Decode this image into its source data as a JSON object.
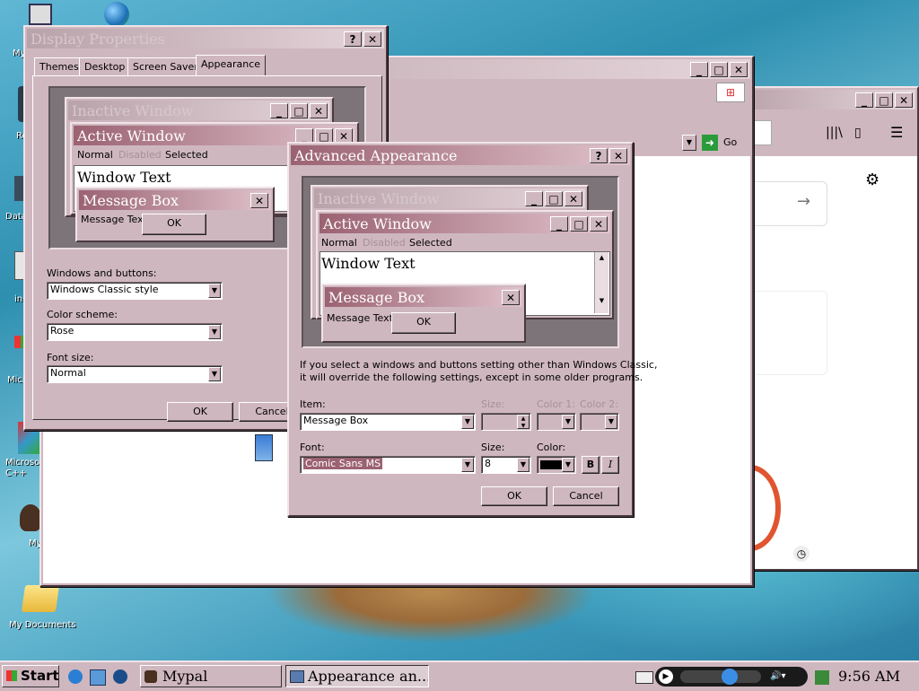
{
  "desktop": {
    "icons": [
      {
        "label": "My",
        "icon": "my-computer-icon"
      },
      {
        "label": "Re",
        "icon": "recycle-bin-icon"
      },
      {
        "label": "Data",
        "icon": "data-icon"
      },
      {
        "label": "ins",
        "icon": "installer-icon"
      },
      {
        "label": "Micro",
        "icon": "microsoft-icon"
      },
      {
        "label": "Microsoft C++",
        "icon": "cpp-shortcut-icon"
      },
      {
        "label": "My",
        "icon": "monkey-shortcut-icon"
      },
      {
        "label": "My Documents",
        "icon": "folder-icon"
      }
    ]
  },
  "browser": {
    "go_label": "Go"
  },
  "display_properties": {
    "title": "Display Properties",
    "tabs": [
      "Themes",
      "Desktop",
      "Screen Saver",
      "Appearance"
    ],
    "preview": {
      "inactive_title": "Inactive Window",
      "active_title": "Active Window",
      "menu_normal": "Normal",
      "menu_disabled": "Disabled",
      "menu_selected": "Selected",
      "window_text": "Window Text",
      "msgbox_title": "Message Box",
      "msgbox_text": "Message Text",
      "msgbox_ok": "OK"
    },
    "windows_buttons_label": "Windows and buttons:",
    "windows_buttons_value": "Windows Classic style",
    "color_scheme_label": "Color scheme:",
    "color_scheme_value": "Rose",
    "font_size_label": "Font size:",
    "font_size_value": "Normal",
    "ok": "OK",
    "cancel": "Cancel"
  },
  "advanced": {
    "title": "Advanced Appearance",
    "preview": {
      "inactive_title": "Inactive Window",
      "active_title": "Active Window",
      "menu_normal": "Normal",
      "menu_disabled": "Disabled",
      "menu_selected": "Selected",
      "window_text": "Window Text",
      "msgbox_title": "Message Box",
      "msgbox_text": "Message Text",
      "msgbox_ok": "OK"
    },
    "info_line1": "If you select a windows and buttons setting other than Windows Classic,",
    "info_line2": "it will override the following settings, except in some older programs.",
    "item_label": "Item:",
    "item_value": "Message Box",
    "size_label_1": "Size:",
    "color1_label": "Color 1:",
    "color2_label": "Color 2:",
    "font_label": "Font:",
    "font_value": "Comic Sans MS",
    "size_label_2": "Size:",
    "size_value": "8",
    "color_label": "Color:",
    "bold": "B",
    "italic": "I",
    "ok": "OK",
    "cancel": "Cancel"
  },
  "taskbar": {
    "start": "Start",
    "buttons": [
      "Mypal",
      "Appearance an..."
    ],
    "clock": "9:56 AM"
  },
  "colors": {
    "face": "#cfb7bf",
    "active_title_start": "#9b6272",
    "active_title_end": "#e0c3cc",
    "inactive_title_start": "#b9a3aa"
  }
}
